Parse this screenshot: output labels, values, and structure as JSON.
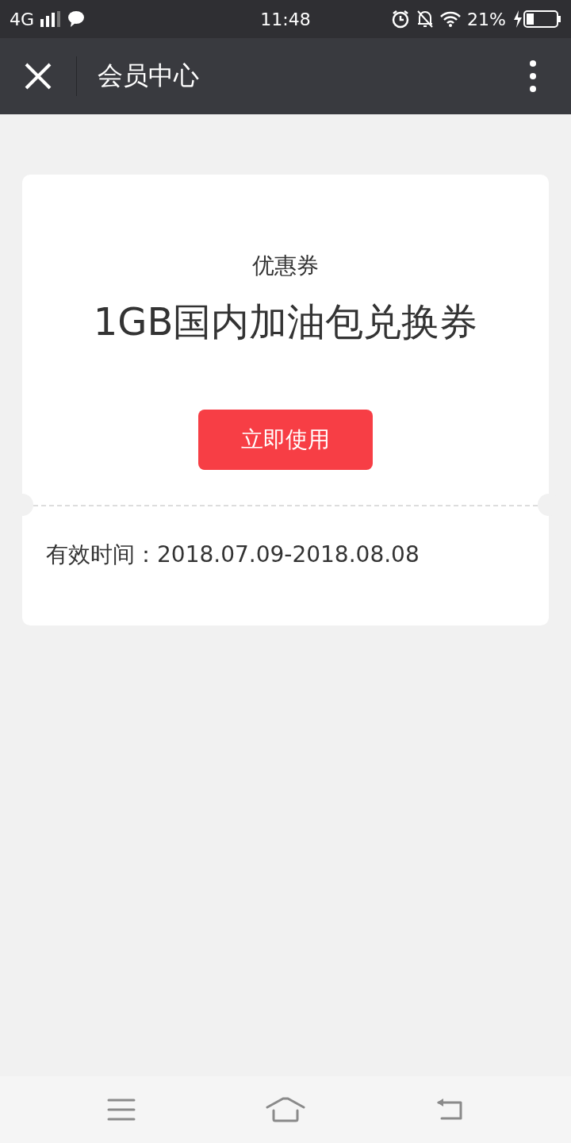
{
  "status_bar": {
    "network": "4G",
    "time": "11:48",
    "battery": "21%"
  },
  "nav_bar": {
    "title": "会员中心"
  },
  "coupon": {
    "label": "优惠券",
    "name": "1GB国内加油包兑换券",
    "action": "立即使用",
    "validity": "有效时间：2018.07.09-2018.08.08"
  }
}
